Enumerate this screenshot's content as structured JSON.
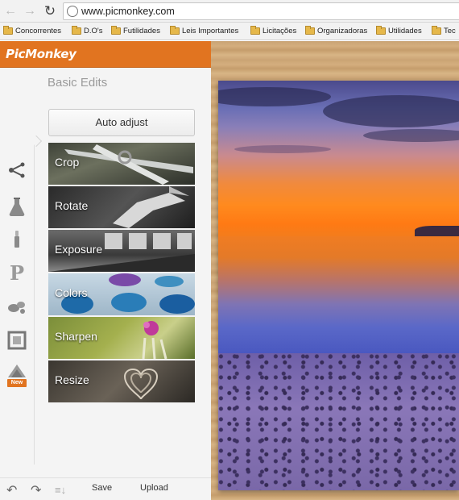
{
  "browser": {
    "url": "www.picmonkey.com",
    "bookmarks": [
      "Concorrentes",
      "D.O's",
      "Futilidades",
      "Leis Importantes",
      "Licitações",
      "Organizadoras",
      "Utilidades",
      "Tec"
    ]
  },
  "app": {
    "logo": "PicMonkey",
    "panel_title": "Basic Edits",
    "auto_adjust_label": "Auto adjust",
    "tools": [
      {
        "label": "Crop"
      },
      {
        "label": "Rotate"
      },
      {
        "label": "Exposure"
      },
      {
        "label": "Colors"
      },
      {
        "label": "Sharpen"
      },
      {
        "label": "Resize"
      }
    ],
    "side_icons": [
      "basic-edits-icon",
      "effects-icon",
      "touch-up-icon",
      "text-icon",
      "overlays-icon",
      "frames-icon",
      "textures-icon"
    ],
    "new_badge": "New",
    "bottom": {
      "save_label": "Save",
      "upload_label": "Upload"
    }
  },
  "colors": {
    "brand_orange": "#e17420",
    "panel_bg": "#f4f4f4"
  }
}
